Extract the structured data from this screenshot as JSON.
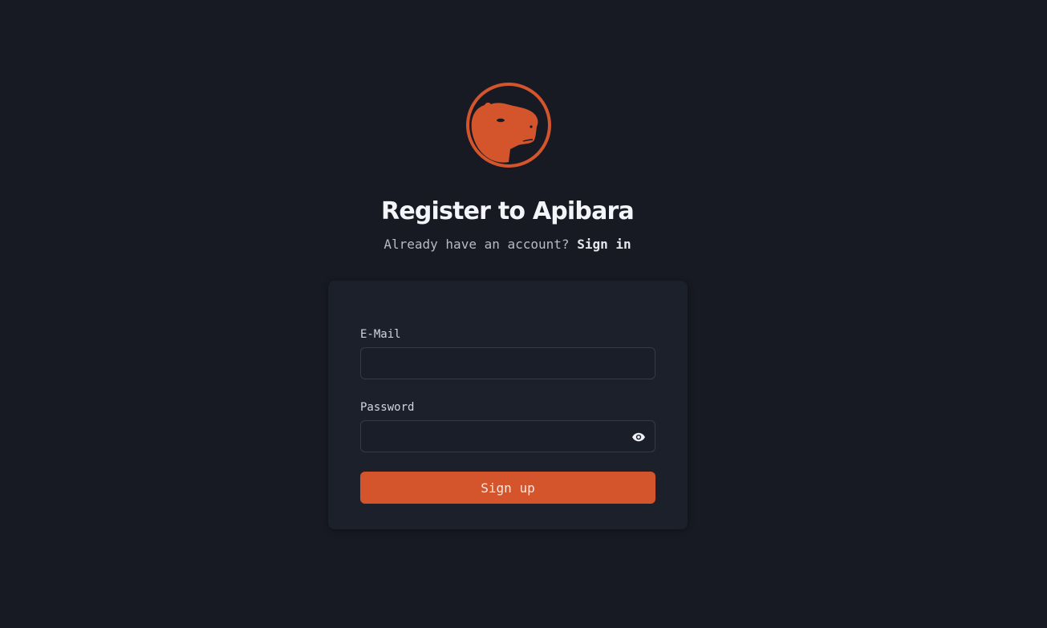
{
  "brand": {
    "logo_icon": "capybara-logo-icon",
    "accent_color": "#d4552c"
  },
  "header": {
    "title": "Register to Apibara",
    "subtitle_prefix": "Already have an account?",
    "signin_link": "Sign in"
  },
  "form": {
    "email_label": "E-Mail",
    "email_value": "",
    "password_label": "Password",
    "password_value": "",
    "password_toggle_icon": "eye-icon",
    "submit_label": "Sign up"
  }
}
